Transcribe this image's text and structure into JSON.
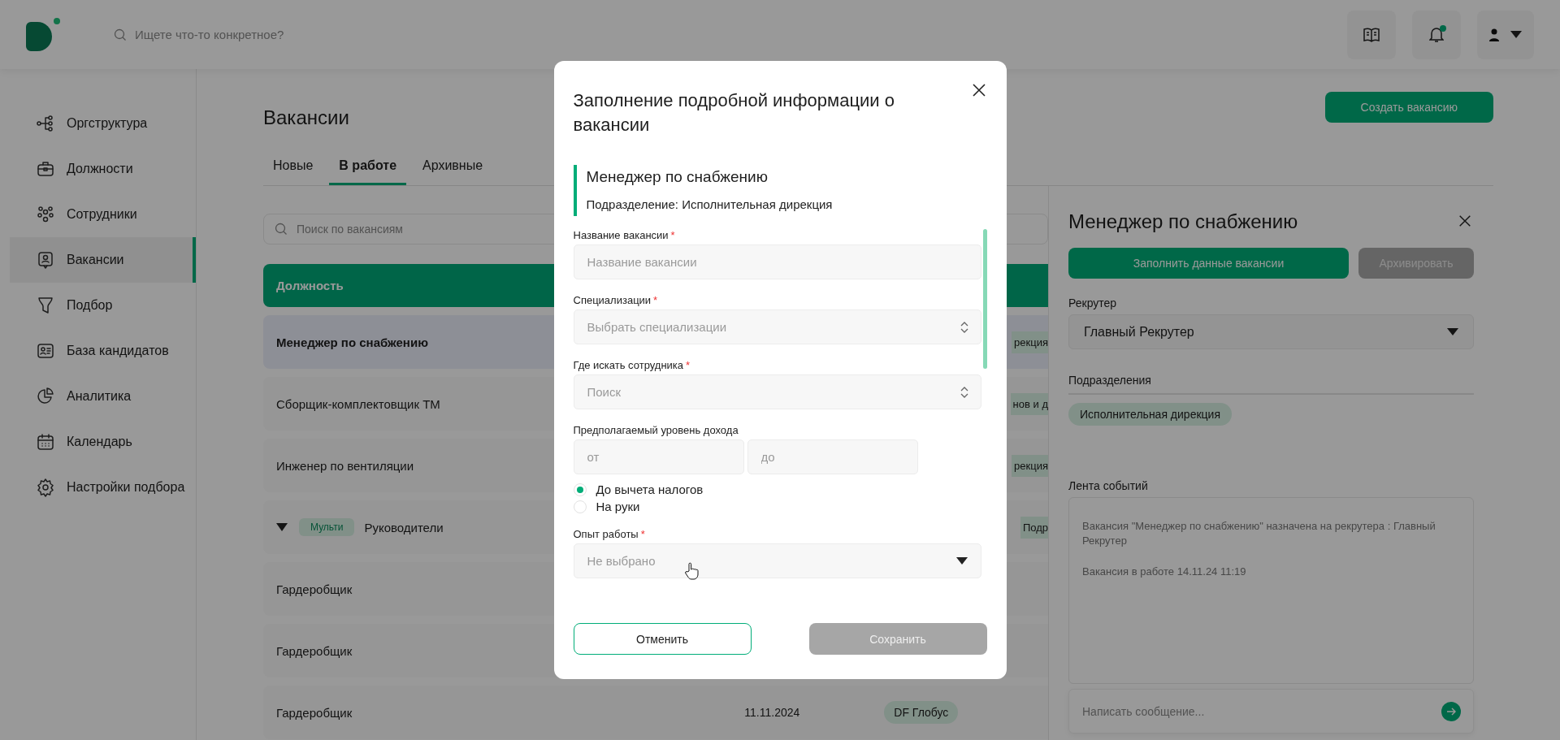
{
  "header": {
    "search_placeholder": "Ищете что-то конкретное?",
    "notification_dot": true
  },
  "sidebar": {
    "items": [
      {
        "label": "Оргструктура",
        "selected": false
      },
      {
        "label": "Должности",
        "selected": false
      },
      {
        "label": "Сотрудники",
        "selected": false
      },
      {
        "label": "Вакансии",
        "selected": true
      },
      {
        "label": "Подбор",
        "selected": false
      },
      {
        "label": "База кандидатов",
        "selected": false
      },
      {
        "label": "Аналитика",
        "selected": false
      },
      {
        "label": "Календарь",
        "selected": false
      },
      {
        "label": "Настройки подбора",
        "selected": false
      }
    ]
  },
  "page": {
    "title": "Вакансии",
    "create_button": "Создать вакансию",
    "tabs": [
      {
        "label": "Новые",
        "selected": false
      },
      {
        "label": "В работе",
        "selected": true
      },
      {
        "label": "Архивные",
        "selected": false
      }
    ],
    "search_placeholder": "Поиск по вакансиям"
  },
  "table": {
    "columns": [
      "Должность"
    ],
    "rows": [
      {
        "kind": "item",
        "title": "Менеджер по снабжению",
        "selected": true,
        "tag": "рекция",
        "tag_cut": true
      },
      {
        "kind": "item",
        "title": "Сборщик-комплектовщик ТМ",
        "selected": false,
        "tag": "нов и д",
        "tag_cut": true
      },
      {
        "kind": "item",
        "title": "Инженер по вентиляции",
        "selected": false,
        "tag": "рекция",
        "tag_cut": true
      },
      {
        "kind": "group",
        "title": "Руководители",
        "badge": "Мульти",
        "expanded": true,
        "selected": false,
        "tag": "Подр",
        "tag_cut": true
      },
      {
        "kind": "item",
        "title": "Гардеробщик",
        "selected": false
      },
      {
        "kind": "item",
        "title": "Гардеробщик",
        "selected": false
      },
      {
        "kind": "item",
        "title": "Гардеробщик",
        "selected": false,
        "date": "11.11.2024",
        "tag": "DF Глобус",
        "tag_cut": false
      }
    ]
  },
  "panel": {
    "title": "Менеджер по снабжению",
    "fill_button": "Заполнить данные вакансии",
    "archive_button": "Архивировать",
    "recruiter_label": "Рекрутер",
    "recruiter_value": "Главный Рекрутер",
    "departments_label": "Подразделения",
    "departments": [
      "Исполнительная дирекция"
    ],
    "feed_label": "Лента событий",
    "events": [
      "Вакансия \"Менеджер по снабжению\" назначена на рекрутера : Главный Рекрутер",
      "Вакансия в работе 14.11.24 11:19"
    ],
    "message_placeholder": "Написать сообщение..."
  },
  "modal": {
    "title": "Заполнение подробной информации о вакансии",
    "vacancy": "Менеджер по снабжению",
    "department": "Подразделение: Исполнительная дирекция",
    "fields": [
      {
        "kind": "text",
        "label": "Название вакансии",
        "required": "*",
        "placeholder": "Название вакансии"
      },
      {
        "kind": "combo",
        "label": "Специализации",
        "required": "*",
        "placeholder": "Выбрать специализации"
      },
      {
        "kind": "combo",
        "label": "Где искать сотрудника",
        "required": "*",
        "placeholder": "Поиск"
      },
      {
        "kind": "range",
        "label": "Предполагаемый уровень дохода",
        "from_placeholder": "от",
        "to_placeholder": "до"
      },
      {
        "kind": "radios",
        "options": [
          {
            "label": "До вычета налогов",
            "selected": true
          },
          {
            "label": "На руки",
            "selected": false
          }
        ]
      },
      {
        "kind": "select",
        "label": "Опыт работы",
        "required": "*",
        "placeholder": "Не выбрано"
      }
    ],
    "cancel_button": "Отменить",
    "save_button": "Сохранить",
    "save_disabled": true
  }
}
